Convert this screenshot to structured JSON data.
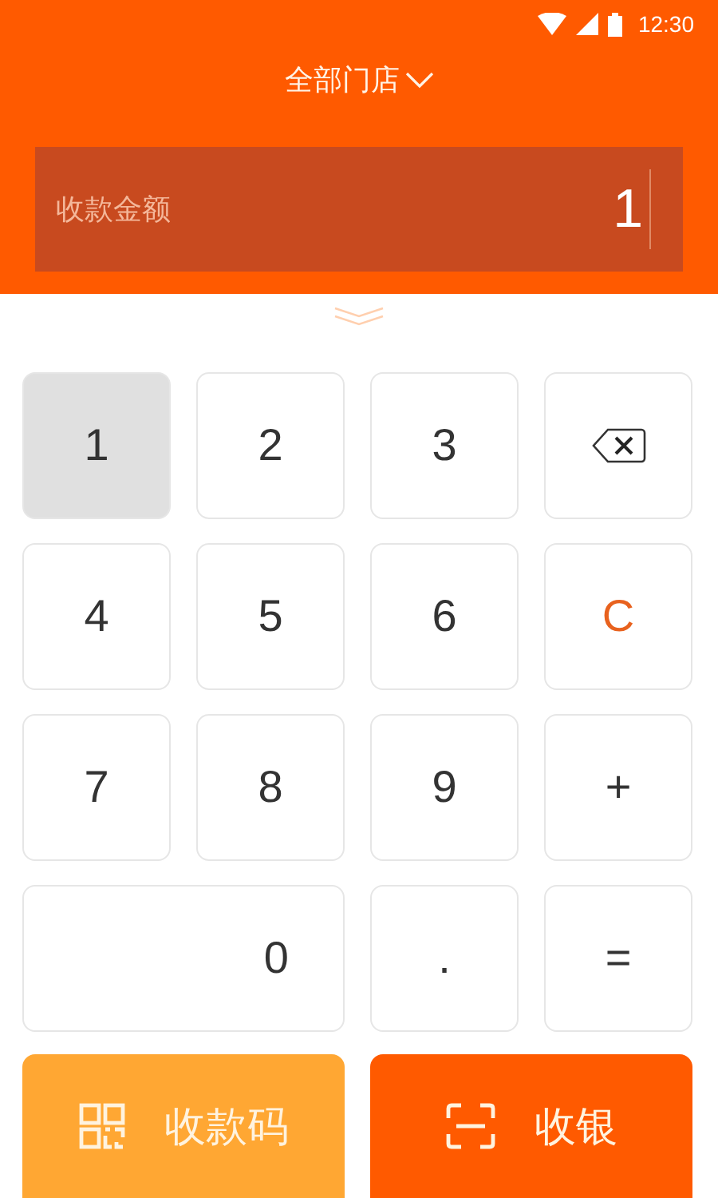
{
  "status_bar": {
    "time": "12:30"
  },
  "header": {
    "store_selector": "全部门店"
  },
  "amount_field": {
    "label": "收款金额",
    "value": "1"
  },
  "keypad": [
    {
      "kind": "digit",
      "label": "1",
      "pressed": true,
      "wide": false
    },
    {
      "kind": "digit",
      "label": "2",
      "pressed": false,
      "wide": false
    },
    {
      "kind": "digit",
      "label": "3",
      "pressed": false,
      "wide": false
    },
    {
      "kind": "backspace",
      "pressed": false,
      "wide": false
    },
    {
      "kind": "digit",
      "label": "4",
      "pressed": false,
      "wide": false
    },
    {
      "kind": "digit",
      "label": "5",
      "pressed": false,
      "wide": false
    },
    {
      "kind": "digit",
      "label": "6",
      "pressed": false,
      "wide": false
    },
    {
      "kind": "clear",
      "label": "C",
      "pressed": false,
      "wide": false
    },
    {
      "kind": "digit",
      "label": "7",
      "pressed": false,
      "wide": false
    },
    {
      "kind": "digit",
      "label": "8",
      "pressed": false,
      "wide": false
    },
    {
      "kind": "digit",
      "label": "9",
      "pressed": false,
      "wide": false
    },
    {
      "kind": "operator",
      "label": "+",
      "pressed": false,
      "wide": false
    },
    {
      "kind": "digit",
      "label": "0",
      "pressed": false,
      "wide": true
    },
    {
      "kind": "digit",
      "label": ".",
      "pressed": false,
      "wide": false
    },
    {
      "kind": "operator",
      "label": "=",
      "pressed": false,
      "wide": false
    }
  ],
  "actions": [
    {
      "kind": "qr",
      "label": "收款码"
    },
    {
      "kind": "scan",
      "label": "收银"
    }
  ]
}
